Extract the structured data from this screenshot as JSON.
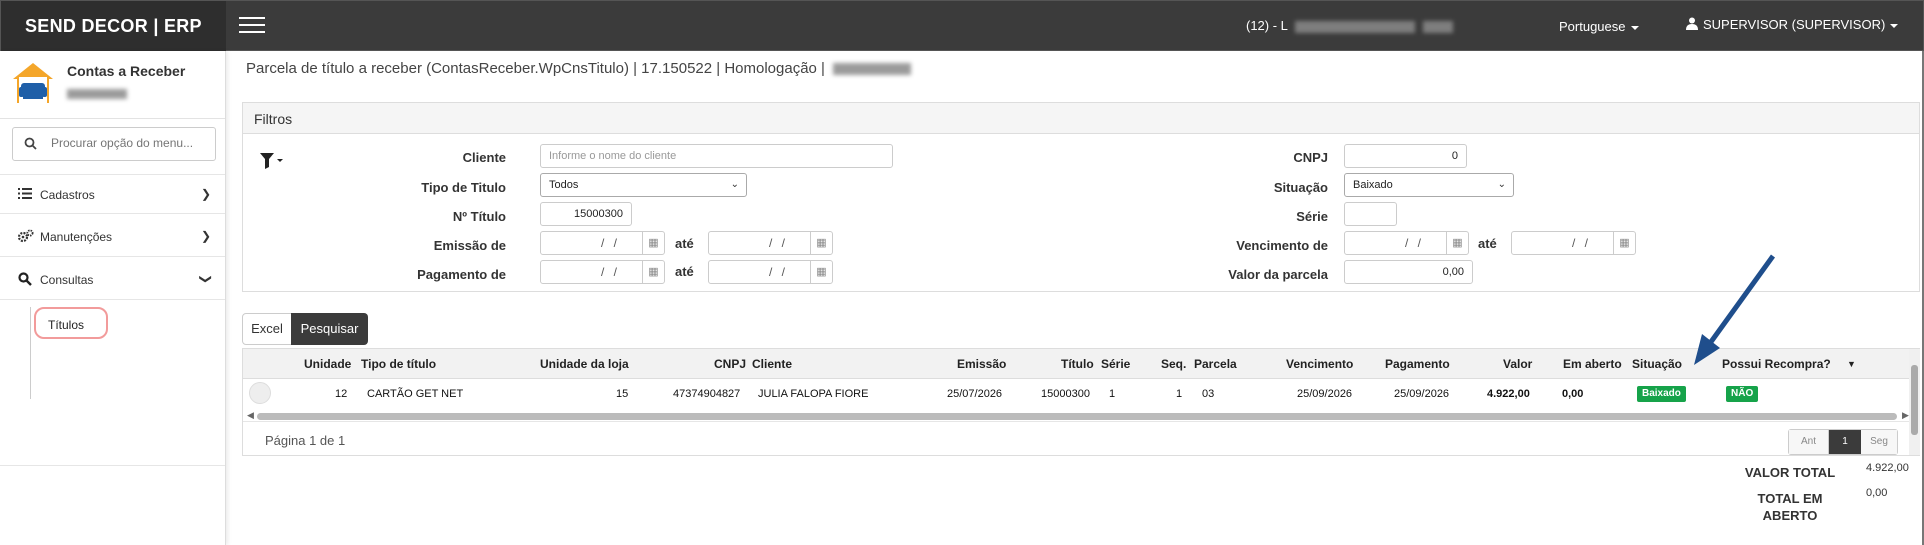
{
  "header": {
    "brand": "SEND DECOR | ERP",
    "company_prefix": "(12) - L",
    "language": "Portuguese",
    "user": "SUPERVISOR (SUPERVISOR)"
  },
  "sidebar": {
    "module_title": "Contas a Receber",
    "search_placeholder": "Procurar opção do menu...",
    "items": [
      {
        "label": "Cadastros",
        "icon": "list-icon"
      },
      {
        "label": "Manutenções",
        "icon": "gears-icon"
      },
      {
        "label": "Consultas",
        "icon": "search-icon"
      }
    ],
    "active_submenu": "Títulos"
  },
  "page": {
    "title": "Parcela de título a receber (ContasReceber.WpCnsTitulo) | 17.150522 | Homologação |"
  },
  "filters": {
    "header": "Filtros",
    "cliente_label": "Cliente",
    "cliente_placeholder": "Informe o nome do cliente",
    "tipo_label": "Tipo de Titulo",
    "tipo_value": "Todos",
    "numero_label": "Nº Título",
    "numero_value": "15000300",
    "emissao_label": "Emissão de",
    "pagamento_label": "Pagamento de",
    "ate_label": "até",
    "date_empty": "/ /",
    "cnpj_label": "CNPJ",
    "cnpj_value": "0",
    "situacao_label": "Situação",
    "situacao_value": "Baixado",
    "serie_label": "Série",
    "serie_value": "",
    "vencimento_label": "Vencimento de",
    "valor_parcela_label": "Valor da parcela",
    "valor_parcela_value": "0,00"
  },
  "actions": {
    "excel": "Excel",
    "pesquisar": "Pesquisar"
  },
  "grid": {
    "columns": [
      "Unidade",
      "Tipo de título",
      "Unidade da loja",
      "CNPJ",
      "Cliente",
      "Emissão",
      "Título",
      "Série",
      "Seq.",
      "Parcela",
      "Vencimento",
      "Pagamento",
      "Valor",
      "Em aberto",
      "Situação",
      "Possui Recompra?"
    ],
    "rows": [
      {
        "unidade": "12",
        "tipo": "CARTÃO GET NET",
        "unidade_loja": "15",
        "cnpj": "47374904827",
        "cliente": "JULIA FALOPA FIORE",
        "emissao": "25/07/2026",
        "titulo": "15000300",
        "serie": "1",
        "seq": "1",
        "parcela": "03",
        "vencimento": "25/09/2026",
        "pagamento": "25/09/2026",
        "valor": "4.922,00",
        "em_aberto": "0,00",
        "situacao": "Baixado",
        "recompra": "NÃO"
      }
    ],
    "pagination_text": "Página 1 de 1",
    "pager": {
      "prev": "Ant",
      "current": "1",
      "next": "Seg"
    }
  },
  "totals": {
    "valor_total_label": "VALOR TOTAL",
    "valor_total": "4.922,00",
    "em_aberto_label": "TOTAL EM ABERTO",
    "em_aberto": "0,00"
  },
  "colors": {
    "topbar": "#3b3b3b",
    "badge_green": "#16a34a",
    "arrow": "#1f4e8c",
    "highlight": "#f29b9b"
  }
}
